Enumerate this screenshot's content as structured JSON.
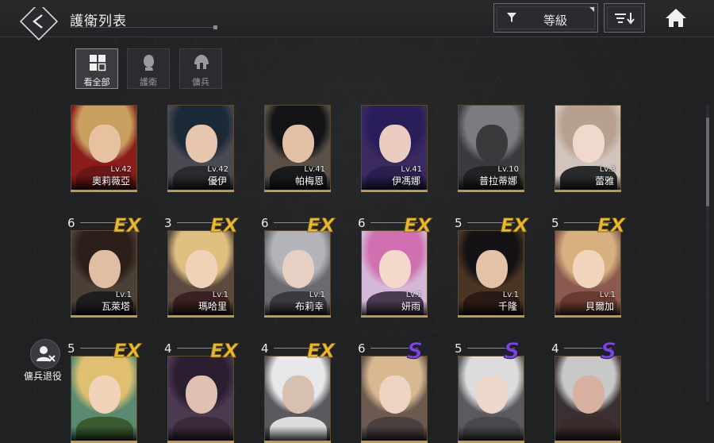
{
  "header": {
    "title": "護衛列表",
    "filter_label": "等級"
  },
  "tabs": [
    {
      "label": "看全部",
      "icon": "grid-icon",
      "active": true
    },
    {
      "label": "護衛",
      "icon": "guard-head-icon",
      "active": false
    },
    {
      "label": "傭兵",
      "icon": "mercenary-helmet-icon",
      "active": false
    }
  ],
  "retire": {
    "label": "傭兵退役",
    "icon": "user-remove-icon"
  },
  "rows": [
    [
      {
        "name": "奧莉薇亞",
        "level": "Lv.42",
        "hair": "#c9a060",
        "skin": "#e8c2a0",
        "body": "#6a1616",
        "bg": "#8a1c1c"
      },
      {
        "name": "優伊",
        "level": "Lv.42",
        "hair": "#1c2a38",
        "skin": "#e6c6ae",
        "body": "#2a2a30",
        "bg": "#4a4a52"
      },
      {
        "name": "帕梅恩",
        "level": "Lv.41",
        "hair": "#141416",
        "skin": "#e2c0a6",
        "body": "#1a1a1c",
        "bg": "#5a5048"
      },
      {
        "name": "伊馮娜",
        "level": "Lv.41",
        "hair": "#2a1e5a",
        "skin": "#eaccc0",
        "body": "#2a2050",
        "bg": "#3a2a60"
      },
      {
        "name": "普拉蒂娜",
        "level": "Lv.10",
        "hair": "#7a7c80",
        "skin": "#3a3a3c",
        "body": "#222224",
        "bg": "#3a3b3e"
      },
      {
        "name": "蕾雅",
        "level": "Lv.3",
        "hair": "#b8a090",
        "skin": "#f0d8cc",
        "body": "#2a2a2a",
        "bg": "#d0c4bc"
      }
    ],
    [
      {
        "name": "瓦萊塔",
        "level": "Lv.1",
        "stars": "6",
        "rank": "EX",
        "hair": "#2c1e18",
        "skin": "#e0bea4",
        "body": "#1e1e20",
        "bg": "#4a4038"
      },
      {
        "name": "瑪哈里",
        "level": "Lv.1",
        "stars": "3",
        "rank": "EX",
        "hair": "#e0c080",
        "skin": "#f0d2b8",
        "body": "#3a2020",
        "bg": "#5a4a40"
      },
      {
        "name": "布莉幸",
        "level": "Lv.1",
        "stars": "6",
        "rank": "EX",
        "hair": "#b4b4b8",
        "skin": "#e6d0c4",
        "body": "#3a3a40",
        "bg": "#6a6a70"
      },
      {
        "name": "妍雨",
        "level": "Lv.1",
        "stars": "6",
        "rank": "EX",
        "hair": "#d070b0",
        "skin": "#f4d8cc",
        "body": "#4a3a50",
        "bg": "#d4b8d8"
      },
      {
        "name": "千隆",
        "level": "Lv.1",
        "stars": "5",
        "rank": "EX",
        "hair": "#141214",
        "skin": "#e4c2a8",
        "body": "#2a1a14",
        "bg": "#4a3424"
      },
      {
        "name": "貝爾加",
        "level": "Lv.1",
        "stars": "5",
        "rank": "EX",
        "hair": "#d8b080",
        "skin": "#f0d4bc",
        "body": "#6a3a30",
        "bg": "#8a5a50"
      }
    ],
    [
      {
        "name": "",
        "level": "",
        "stars": "5",
        "rank": "EX",
        "hair": "#e0c070",
        "skin": "#f0d2b8",
        "body": "#3a5a30",
        "bg": "#5a8a70"
      },
      {
        "name": "",
        "level": "",
        "stars": "4",
        "rank": "EX",
        "hair": "#2a1e30",
        "skin": "#e0c0b0",
        "body": "#3a2a3a",
        "bg": "#4a3a50"
      },
      {
        "name": "",
        "level": "",
        "stars": "4",
        "rank": "EX",
        "hair": "#e8e8ea",
        "skin": "#d8c0b0",
        "body": "#ddd",
        "bg": "#5a5a5e"
      },
      {
        "name": "",
        "level": "",
        "stars": "6",
        "rank": "S",
        "hair": "#d8b890",
        "skin": "#eed4c0",
        "body": "#4a4040",
        "bg": "#6a5a50"
      },
      {
        "name": "",
        "level": "",
        "stars": "5",
        "rank": "S",
        "hair": "#dcdcdc",
        "skin": "#eed8cc",
        "body": "#4a4a4e",
        "bg": "#5a5a60"
      },
      {
        "name": "",
        "level": "",
        "stars": "4",
        "rank": "S",
        "hair": "#c8c8c8",
        "skin": "#d8b0a0",
        "body": "#3a2a2a",
        "bg": "#3a3034"
      }
    ]
  ],
  "colors": {
    "accent_gold": "#e8b830",
    "rank_s_purple": "#7a48d8",
    "frame_gold": "#b89a58"
  }
}
